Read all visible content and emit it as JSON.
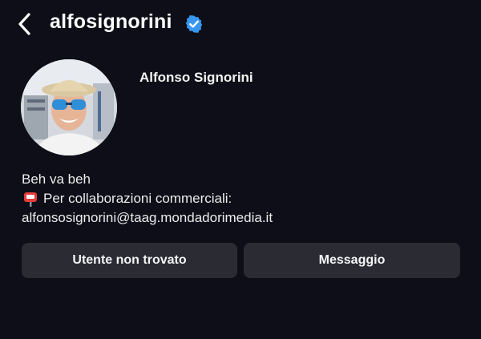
{
  "header": {
    "username": "alfosignorini",
    "back_icon": "chevron-left-icon",
    "verified_icon": "verified-badge-icon",
    "verified_color": "#3797f0"
  },
  "profile": {
    "display_name": "Alfonso Signorini",
    "avatar": "profile-photo"
  },
  "bio": {
    "line1": "Beh va beh",
    "line2_icon": "mailbox-icon",
    "line2": "Per collaborazioni commerciali:",
    "line3": "alfonsosignorini@taag.mondadorimedia.it"
  },
  "actions": {
    "not_found_label": "Utente non trovato",
    "message_label": "Messaggio"
  },
  "colors": {
    "background": "#0d0e17",
    "button": "#2a2b33"
  }
}
